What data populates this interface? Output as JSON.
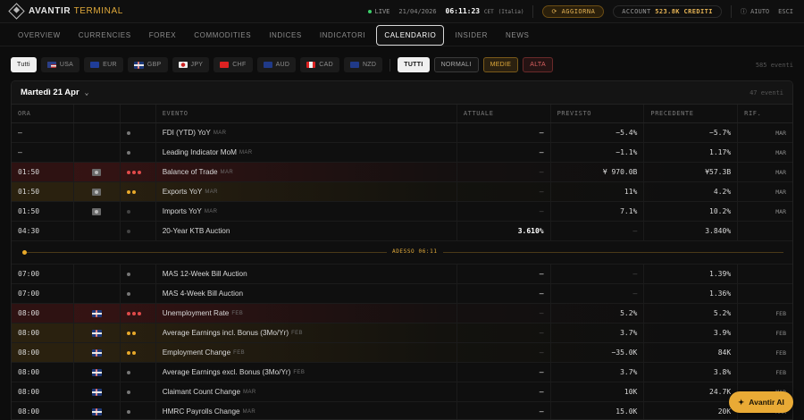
{
  "app": {
    "brand_a": "AVANTIR",
    "brand_b": "TERMINAL"
  },
  "status": {
    "live": "LIVE",
    "date": "21/04/2026",
    "time": "06:11:23",
    "tz": "CET",
    "tz_city": "(Italia)",
    "refresh": "AGGIORNA",
    "account_label": "ACCOUNT",
    "account_value": "523.8K CREDITI",
    "help": "AIUTO",
    "exit": "ESCI"
  },
  "nav": [
    "OVERVIEW",
    "CURRENCIES",
    "FOREX",
    "COMMODITIES",
    "INDICES",
    "INDICATORI",
    "CALENDARIO",
    "INSIDER",
    "NEWS"
  ],
  "nav_active": "CALENDARIO",
  "filters": {
    "currencies": [
      {
        "label": "Tutti"
      },
      {
        "label": "USA"
      },
      {
        "label": "EUR"
      },
      {
        "label": "GBP"
      },
      {
        "label": "JPY"
      },
      {
        "label": "CHF"
      },
      {
        "label": "AUD"
      },
      {
        "label": "CAD"
      },
      {
        "label": "NZD"
      }
    ],
    "impact": [
      "TUTTI",
      "NORMALI",
      "MEDIE",
      "ALTA"
    ],
    "count": "585 eventi"
  },
  "day": {
    "title": "Martedì 21 Apr",
    "count": "47 eventi"
  },
  "columns": [
    "ORA",
    "",
    "",
    "EVENTO",
    "ATTUALE",
    "PREVISTO",
    "PRECEDENTE",
    "RIF."
  ],
  "now_label": "ADESSO 06:11",
  "rows_before": [
    {
      "time": "–",
      "flag": "",
      "imp": "low",
      "event": "FDI (YTD) YoY",
      "per": "MAR",
      "actual": "–",
      "forecast": "−5.4%",
      "previous": "−5.7%",
      "ref": "MAR"
    },
    {
      "time": "–",
      "flag": "",
      "imp": "low",
      "event": "Leading Indicator MoM",
      "per": "MAR",
      "actual": "–",
      "forecast": "−1.1%",
      "previous": "1.17%",
      "ref": "MAR"
    },
    {
      "time": "01:50",
      "flag": "jp",
      "imp": "high",
      "event": "Balance of Trade",
      "per": "MAR",
      "actual": "–",
      "forecast": "¥ 970.0B",
      "previous": "¥57.3B",
      "ref": "MAR"
    },
    {
      "time": "01:50",
      "flag": "jp",
      "imp": "med",
      "event": "Exports YoY",
      "per": "MAR",
      "actual": "–",
      "forecast": "11%",
      "previous": "4.2%",
      "ref": "MAR"
    },
    {
      "time": "01:50",
      "flag": "jp",
      "imp": "none",
      "event": "Imports YoY",
      "per": "MAR",
      "actual": "–",
      "forecast": "7.1%",
      "previous": "10.2%",
      "ref": "MAR"
    },
    {
      "time": "04:30",
      "flag": "",
      "imp": "none",
      "event": "20-Year KTB Auction",
      "per": "",
      "actual": "3.610%",
      "forecast": "–",
      "previous": "3.840%",
      "ref": ""
    }
  ],
  "rows_after": [
    {
      "time": "07:00",
      "flag": "",
      "imp": "low",
      "event": "MAS 12-Week Bill Auction",
      "per": "",
      "actual": "–",
      "forecast": "–",
      "previous": "1.39%",
      "ref": ""
    },
    {
      "time": "07:00",
      "flag": "",
      "imp": "low",
      "event": "MAS 4-Week Bill Auction",
      "per": "",
      "actual": "–",
      "forecast": "–",
      "previous": "1.36%",
      "ref": ""
    },
    {
      "time": "08:00",
      "flag": "uk",
      "imp": "high",
      "event": "Unemployment Rate",
      "per": "FEB",
      "actual": "–",
      "forecast": "5.2%",
      "previous": "5.2%",
      "ref": "FEB"
    },
    {
      "time": "08:00",
      "flag": "uk",
      "imp": "med",
      "event": "Average Earnings incl. Bonus (3Mo/Yr)",
      "per": "FEB",
      "actual": "–",
      "forecast": "3.7%",
      "previous": "3.9%",
      "ref": "FEB"
    },
    {
      "time": "08:00",
      "flag": "uk",
      "imp": "med",
      "event": "Employment Change",
      "per": "FEB",
      "actual": "–",
      "forecast": "−35.0K",
      "previous": "84K",
      "ref": "FEB"
    },
    {
      "time": "08:00",
      "flag": "uk",
      "imp": "low",
      "event": "Average Earnings excl. Bonus (3Mo/Yr)",
      "per": "FEB",
      "actual": "–",
      "forecast": "3.7%",
      "previous": "3.8%",
      "ref": "FEB"
    },
    {
      "time": "08:00",
      "flag": "uk",
      "imp": "low",
      "event": "Claimant Count Change",
      "per": "MAR",
      "actual": "–",
      "forecast": "10K",
      "previous": "24.7K",
      "ref": "MAR"
    },
    {
      "time": "08:00",
      "flag": "uk",
      "imp": "low",
      "event": "HMRC Payrolls Change",
      "per": "MAR",
      "actual": "–",
      "forecast": "15.0K",
      "previous": "20K",
      "ref": "MAR"
    }
  ],
  "ai_button": "Avantir AI",
  "colors": {
    "accent": "#e0a93a",
    "high": "#e04a4a",
    "medium": "#e8a92a",
    "live": "#3ccf6a"
  }
}
